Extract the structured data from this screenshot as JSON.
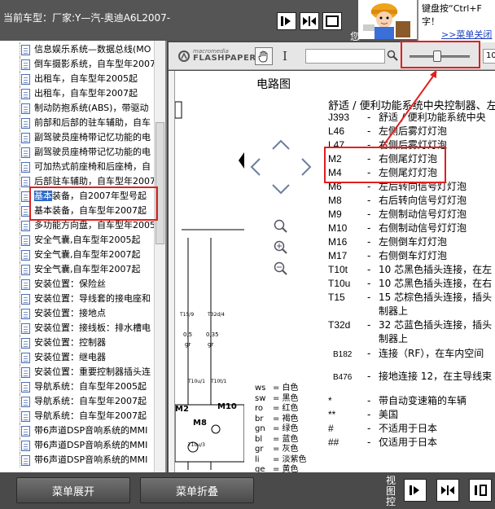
{
  "topbar": {
    "car_model": "当前车型：厂家:Y—汽-奥迪A6L2007-",
    "cut_char": "您"
  },
  "tip": {
    "line1": "键盘按“Ctrl+F",
    "line2": "字！",
    "link": ">>菜单关闭"
  },
  "sidebar": {
    "items": [
      {
        "label": "信息娱乐系统—数据总线(MO"
      },
      {
        "label": "倒车摄影系统，自车型年2007"
      },
      {
        "label": "出租车，自车型年2005起"
      },
      {
        "label": "出租车，自车型年2007起"
      },
      {
        "label": "制动防抱系统(ABS)，带驱动"
      },
      {
        "label": "前部和后部的驻车辅助，自车"
      },
      {
        "label": "副驾驶员座椅带记忆功能的电"
      },
      {
        "label": "副驾驶员座椅带记忆功能的电"
      },
      {
        "label": "可加热式前座椅和后座椅，自"
      },
      {
        "label": "后部驻车辅助，自车型年2007"
      },
      {
        "label": "基本装备，自2007年型号起",
        "selected": true,
        "hl": "基本",
        "rest": "装备，自2007年型号起"
      },
      {
        "label": "基本装备，自车型年2007起"
      },
      {
        "label": "多功能方向盘，自车型年2005"
      },
      {
        "label": "安全气囊,自车型年2005起"
      },
      {
        "label": "安全气囊,自车型年2007起"
      },
      {
        "label": "安全气囊,自车型年2007起"
      },
      {
        "label": "安装位置：保险丝"
      },
      {
        "label": "安装位置：导线套的接电座和"
      },
      {
        "label": "安装位置：接地点"
      },
      {
        "label": "安装位置：接线板：排水槽电"
      },
      {
        "label": "安装位置：控制器"
      },
      {
        "label": "安装位置：继电器"
      },
      {
        "label": "安装位置：重要控制器插头连"
      },
      {
        "label": "导航系统：自车型年2005起"
      },
      {
        "label": "导航系统：自车型年2007起"
      },
      {
        "label": "导航系统：自车型年2007起"
      },
      {
        "label": "带6声道DSP音响系统的MMI"
      },
      {
        "label": "带6声道DSP音响系统的MMI"
      },
      {
        "label": "带6声道DSP音响系统的MMI"
      }
    ]
  },
  "flashpaper": {
    "logo_top": "macromedia",
    "logo_bottom": "FLASHPAPER",
    "zoom_value": "10",
    "zoom_level": 0.45
  },
  "doc": {
    "title": "电路图",
    "heading": "舒适 / 便利功能系统中央控制器、左",
    "legend": [
      {
        "code": "J393",
        "text": "舒适 / 便利功能系统中央"
      },
      {
        "code": "L46",
        "text": "左侧后雾灯灯泡"
      },
      {
        "code": "L47",
        "text": "右侧后雾灯灯泡"
      },
      {
        "code": "M2",
        "text": "右侧尾灯灯泡"
      },
      {
        "code": "M4",
        "text": "左侧尾灯灯泡"
      },
      {
        "code": "M6",
        "text": "左后转向信号灯灯泡"
      },
      {
        "code": "M8",
        "text": "右后转向信号灯灯泡"
      },
      {
        "code": "M9",
        "text": "左侧制动信号灯灯泡"
      },
      {
        "code": "M10",
        "text": "右侧制动信号灯灯泡"
      },
      {
        "code": "M16",
        "text": "左侧倒车灯灯泡"
      },
      {
        "code": "M17",
        "text": "右侧倒车灯灯泡"
      },
      {
        "code": "T10t",
        "text": "10 芯黑色插头连接，在左"
      },
      {
        "code": "T10u",
        "text": "10 芯黑色插头连接，在右"
      },
      {
        "code": "T15",
        "text": "15 芯棕色插头连接，插头"
      },
      {
        "code": "",
        "text": "制器上"
      },
      {
        "code": "T32d",
        "text": "32 芯蓝色插头连接，插头"
      },
      {
        "code": "",
        "text": "制器上"
      },
      {
        "code": "B182",
        "text": "连接（RF），在车内空间"
      },
      {
        "code": "B476",
        "text": "接地连接 12，在主导线束"
      },
      {
        "code": "*",
        "text": "带自动变速箱的车辆"
      },
      {
        "code": "**",
        "text": "美国"
      },
      {
        "code": "#",
        "text": "不适用于日本"
      },
      {
        "code": "##",
        "text": "仅适用于日本"
      }
    ],
    "colors": [
      {
        "k": "ws",
        "v": "= 白色"
      },
      {
        "k": "sw",
        "v": "= 黑色"
      },
      {
        "k": "ro",
        "v": "= 红色"
      },
      {
        "k": "br",
        "v": "= 褐色"
      },
      {
        "k": "gn",
        "v": "= 绿色"
      },
      {
        "k": "bl",
        "v": "= 蓝色"
      },
      {
        "k": "gr",
        "v": "= 灰色"
      },
      {
        "k": "li",
        "v": "= 淡紫色"
      },
      {
        "k": "ge",
        "v": "= 黄色"
      }
    ],
    "schematic_labels": [
      "T15/9",
      "T32d/4",
      "0,5",
      "0,35",
      "gr",
      "gr",
      "T10u/1",
      "T10t/1",
      "M2",
      "M10",
      "M8",
      "T10u/3"
    ]
  },
  "bottombar": {
    "expand_label": "菜单展开",
    "collapse_label": "菜单折叠",
    "view_label": "视图控"
  },
  "colors": {
    "highlight": "#316ac5",
    "annotation": "#e02020",
    "chrome": "#4a4a4a"
  }
}
